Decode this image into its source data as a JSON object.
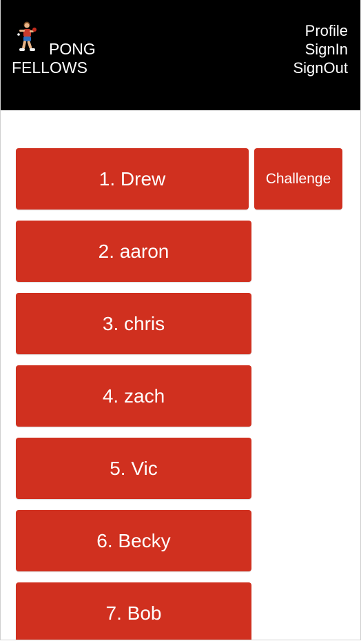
{
  "header": {
    "logo_icon": "ping-pong-player-icon",
    "brand_line1": "PONG",
    "brand_line2": "FELLOWS",
    "nav": {
      "profile": "Profile",
      "signin": "SignIn",
      "signout": "SignOut"
    }
  },
  "ladder": {
    "challenge_label": "Challenge",
    "players": [
      {
        "label": "1. Drew"
      },
      {
        "label": "2. aaron"
      },
      {
        "label": "3. chris"
      },
      {
        "label": "4. zach"
      },
      {
        "label": "5. Vic"
      },
      {
        "label": "6. Becky"
      },
      {
        "label": "7. Bob"
      }
    ]
  },
  "colors": {
    "header_bg": "#000000",
    "button_red": "#d0301f",
    "text_on_red": "#ffffff"
  }
}
